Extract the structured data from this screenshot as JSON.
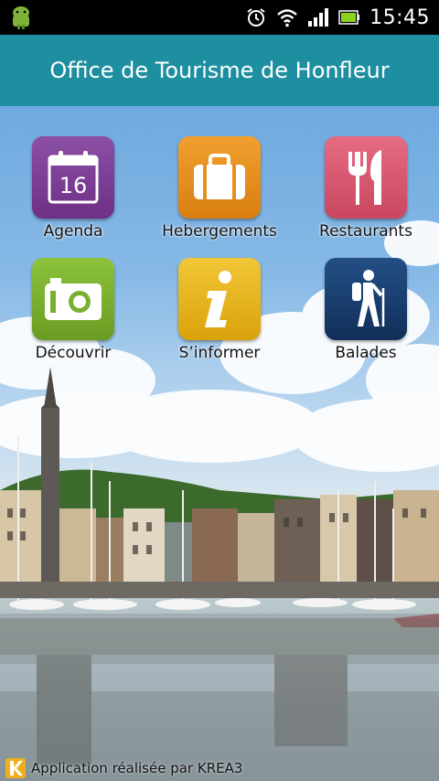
{
  "status_bar": {
    "time": "15:45",
    "icons": [
      "android-icon",
      "alarm-icon",
      "wifi-icon",
      "signal-icon",
      "battery-icon"
    ]
  },
  "header": {
    "title": "Office de Tourisme de Honfleur"
  },
  "menu": {
    "agenda": {
      "label": "Agenda",
      "icon": "calendar-icon",
      "color": "#7d3f96",
      "day": "16"
    },
    "hebergements": {
      "label": "Hebergements",
      "icon": "suitcase-icon",
      "color": "#e58f1c"
    },
    "restaurants": {
      "label": "Restaurants",
      "icon": "fork-knife-icon",
      "color": "#d8566f"
    },
    "decouvrir": {
      "label": "Découvrir",
      "icon": "camera-icon",
      "color": "#7aae2d"
    },
    "sinformer": {
      "label": "S’informer",
      "icon": "info-icon",
      "color": "#e6b417"
    },
    "balades": {
      "label": "Balades",
      "icon": "hiker-icon",
      "color": "#173f73"
    }
  },
  "footer": {
    "credit": "Application réalisée par KREA3"
  },
  "colors": {
    "header": "#1d8fa0"
  }
}
